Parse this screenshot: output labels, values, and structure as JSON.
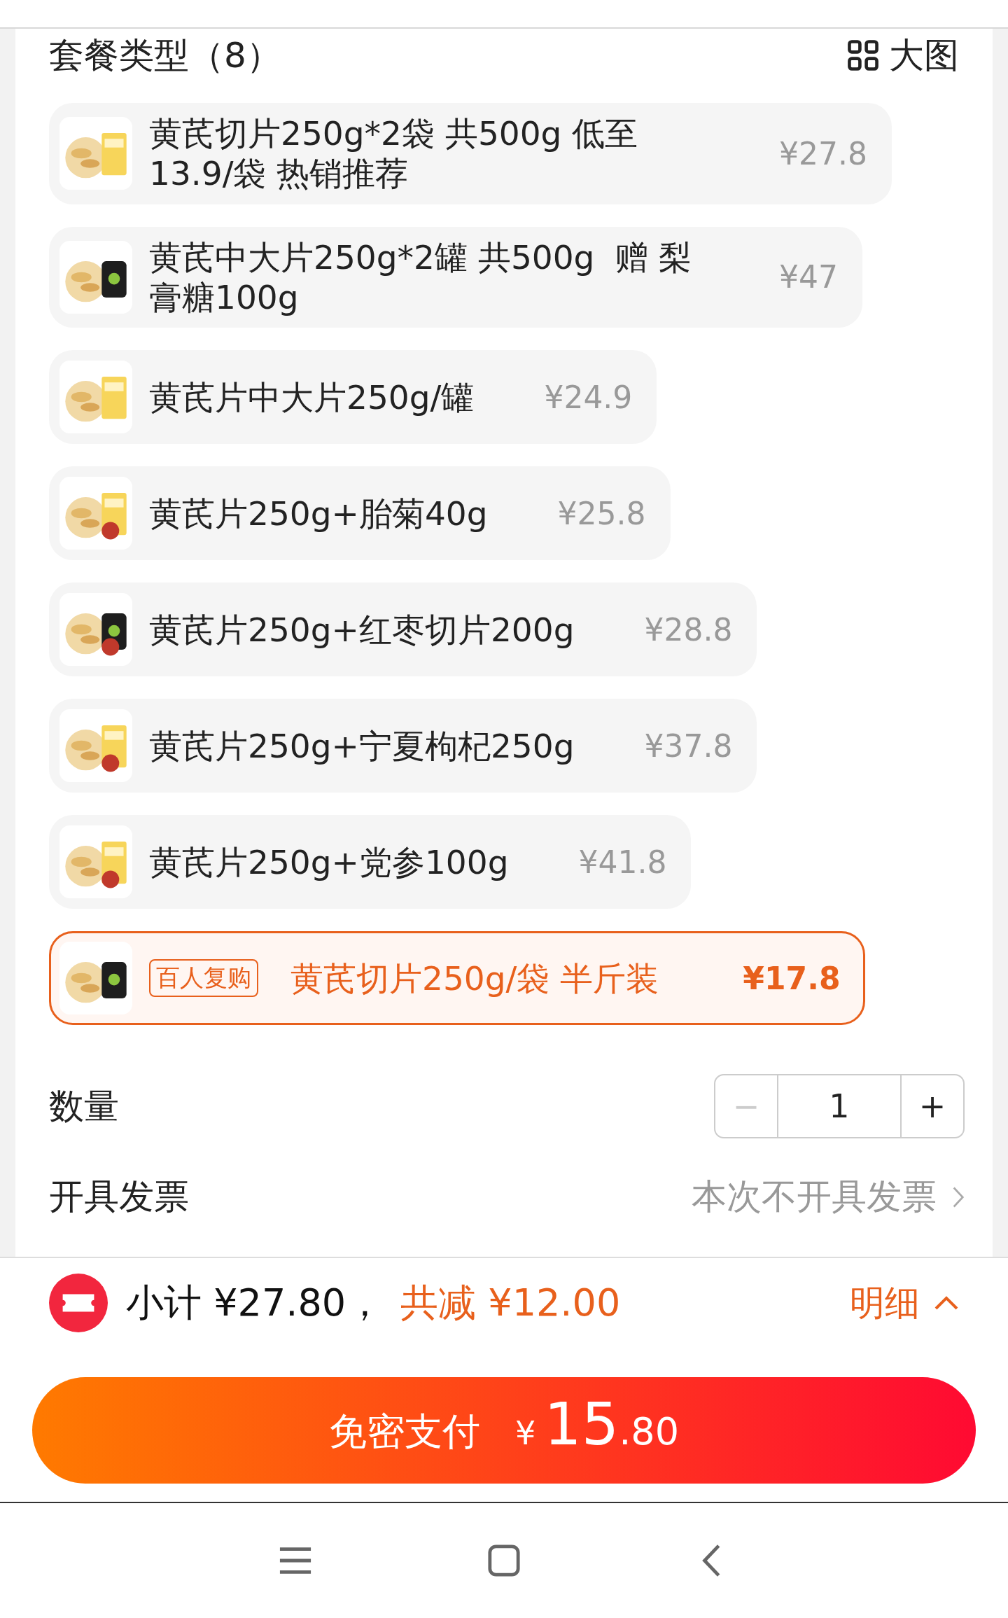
{
  "header": {
    "title": "套餐类型（8）",
    "view_toggle": "大图"
  },
  "options": [
    {
      "name": "黄芪切片250g*2袋 共500g 低至13.9/袋 热销推荐",
      "price": "¥27.8",
      "selected": false
    },
    {
      "name": "黄芪中大片250g*2罐 共500g  赠 梨膏糖100g",
      "price": "¥47",
      "selected": false
    },
    {
      "name": "黄芪片中大片250g/罐",
      "price": "¥24.9",
      "selected": false
    },
    {
      "name": "黄芪片250g+胎菊40g",
      "price": "¥25.8",
      "selected": false
    },
    {
      "name": "黄芪片250g+红枣切片200g",
      "price": "¥28.8",
      "selected": false
    },
    {
      "name": "黄芪片250g+宁夏枸杞250g",
      "price": "¥37.8",
      "selected": false
    },
    {
      "name": "黄芪片250g+党参100g",
      "price": "¥41.8",
      "selected": false
    },
    {
      "name": "黄芪切片250g/袋 半斤装",
      "price": "¥17.8",
      "selected": true,
      "badge": "百人复购"
    }
  ],
  "quantity": {
    "label": "数量",
    "decrement": "−",
    "value": "1",
    "increment": "+",
    "decrement_disabled": true
  },
  "invoice": {
    "label": "开具发票",
    "value": "本次不开具发票"
  },
  "summary": {
    "subtotal": "小计 ¥27.80，",
    "discount": "共减 ¥12.00",
    "details": "明细"
  },
  "pay_button": {
    "label": "免密支付",
    "currency": "¥",
    "amount_int": "15",
    "amount_dec": ".80"
  }
}
